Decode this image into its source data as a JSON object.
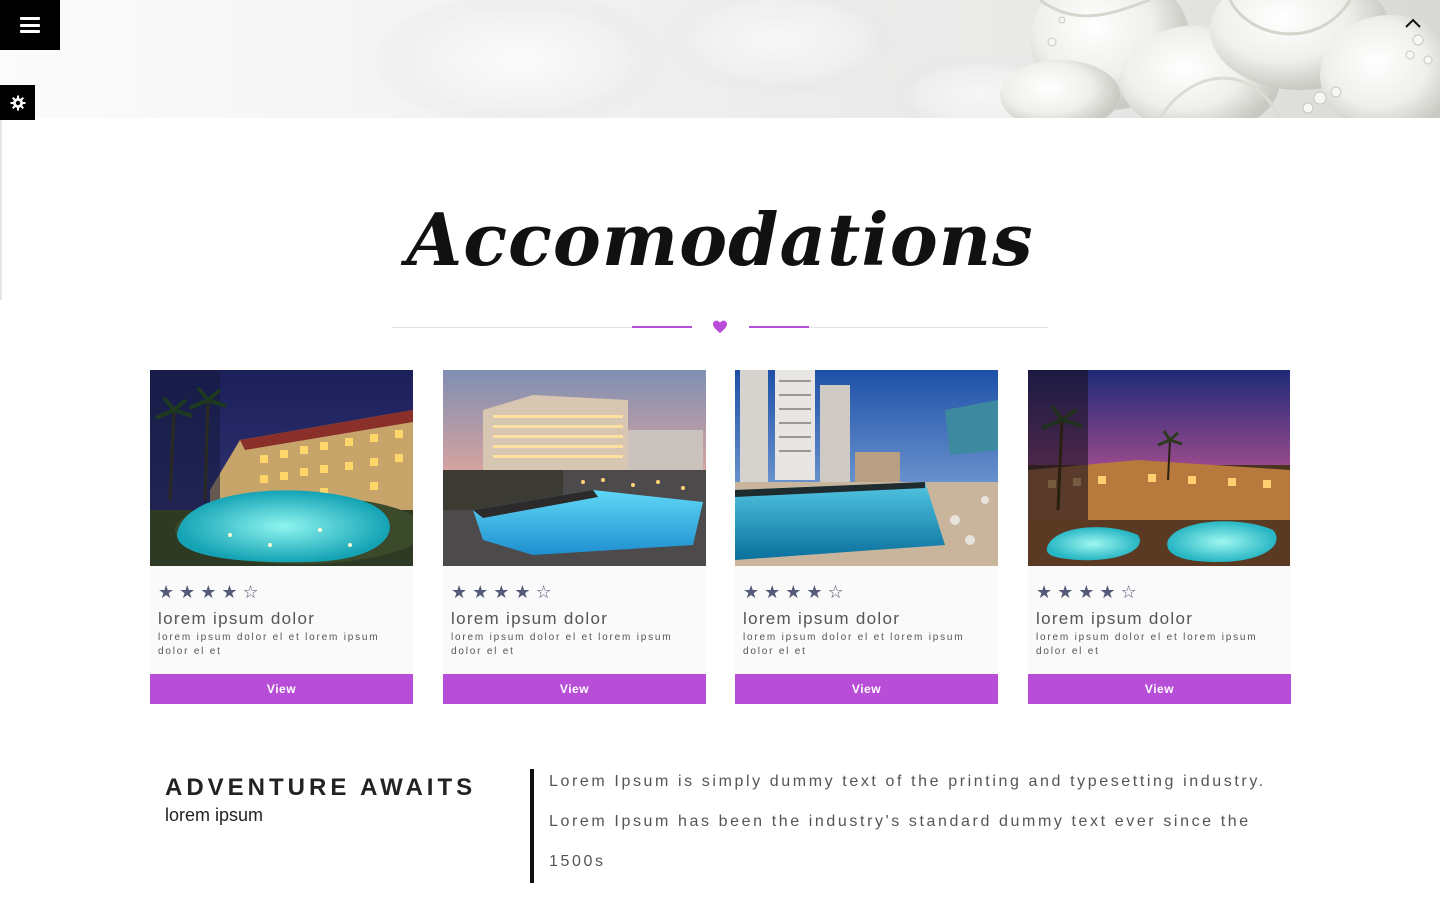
{
  "nav": {
    "menu_icon": "hamburger-icon",
    "settings_icon": "gear-icon",
    "scroll_top_icon": "chevron-up-icon"
  },
  "section": {
    "title": "Accomodations",
    "divider_icon": "heart-icon"
  },
  "colors": {
    "accent": "#b84ed8",
    "star": "#545a78",
    "card_bg": "#fafafa",
    "black": "#000000"
  },
  "cards": [
    {
      "rating": 4,
      "max_rating": 5,
      "stars": "★★★★☆",
      "title": "lorem ipsum dolor",
      "description": "lorem ipsum dolor el et lorem ipsum dolor el et",
      "button": "View",
      "photo": "resort-night-pool"
    },
    {
      "rating": 4,
      "max_rating": 5,
      "stars": "★★★★☆",
      "title": "lorem ipsum dolor",
      "description": "lorem ipsum dolor el et lorem ipsum dolor el et",
      "button": "View",
      "photo": "hotel-sunset-pool"
    },
    {
      "rating": 4,
      "max_rating": 5,
      "stars": "★★★★☆",
      "title": "lorem ipsum dolor",
      "description": "lorem ipsum dolor el et lorem ipsum dolor el et",
      "button": "View",
      "photo": "rooftop-infinity-pool"
    },
    {
      "rating": 4,
      "max_rating": 5,
      "stars": "★★★★☆",
      "title": "lorem ipsum dolor",
      "description": "lorem ipsum dolor el et lorem ipsum dolor el et",
      "button": "View",
      "photo": "desert-resort-dusk"
    }
  ],
  "adventure": {
    "title": "ADVENTURE AWAITS",
    "subtitle": "lorem ipsum",
    "text": "Lorem Ipsum is simply dummy text of the printing and typesetting industry. Lorem Ipsum has been the industry's standard dummy text ever since the 1500s"
  }
}
